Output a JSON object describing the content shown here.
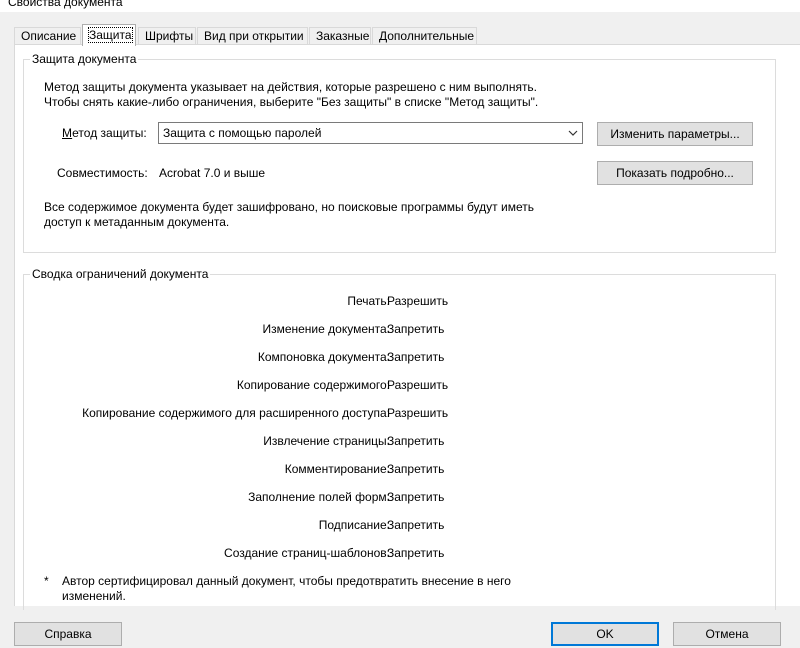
{
  "window": {
    "title": "Свойства документа"
  },
  "tabs": [
    {
      "label": "Описание"
    },
    {
      "label": "Защита",
      "active": true
    },
    {
      "label": "Шрифты"
    },
    {
      "label": "Вид при открытии"
    },
    {
      "label": "Заказные"
    },
    {
      "label": "Дополнительные"
    }
  ],
  "security": {
    "legend": "Защита документа",
    "intro_line1": "Метод защиты документа указывает на действия, которые разрешено с ним выполнять.",
    "intro_line2": "Чтобы снять какие-либо ограничения, выберите \"Без защиты\" в списке \"Метод защиты\".",
    "method_label": "Метод защиты:",
    "method_value": "Защита с помощью паролей",
    "change_settings_button": "Изменить параметры...",
    "compat_label": "Совместимость:",
    "compat_value": "Acrobat 7.0 и выше",
    "show_details_button": "Показать подробно...",
    "encrypt_note_line1": "Все содержимое документа будет зашифровано, но поисковые программы будут иметь",
    "encrypt_note_line2": "доступ к метаданным документа."
  },
  "restrictions": {
    "legend": "Сводка ограничений документа",
    "rows": [
      {
        "label": "Печать:",
        "value": "Разрешить"
      },
      {
        "label": "Изменение документа:",
        "value": "Запретить"
      },
      {
        "label": "Компоновка документа:",
        "value": "Запретить"
      },
      {
        "label": "Копирование содержимого:",
        "value": "Разрешить"
      },
      {
        "label": "Копирование содержимого для расширенного доступа:",
        "value": "Разрешить"
      },
      {
        "label": "Извлечение страницы:",
        "value": "Запретить"
      },
      {
        "label": "Комментирование:",
        "value": "Запретить"
      },
      {
        "label": "Заполнение полей форм:",
        "value": "Запретить"
      },
      {
        "label": "Подписание:",
        "value": "Запретить"
      },
      {
        "label": "Создание страниц-шаблонов:",
        "value": "Запретить"
      }
    ],
    "footnote_mark": "*",
    "footnote_line1": "Автор сертифицировал данный документ, чтобы предотвратить внесение в него",
    "footnote_line2": "изменений."
  },
  "footer": {
    "help_button": "Справка",
    "ok_button": "OK",
    "cancel_button": "Отмена"
  },
  "icons": {
    "combo_arrow": "chevron-down-icon"
  }
}
